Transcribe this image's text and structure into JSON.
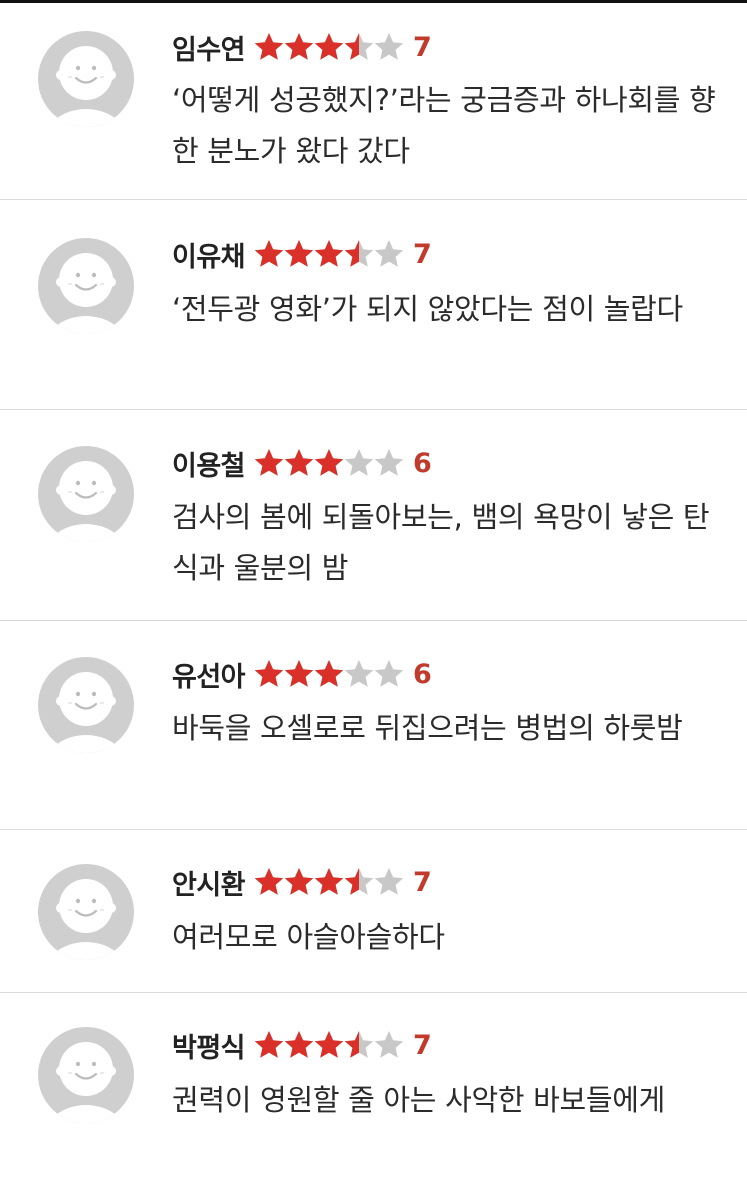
{
  "colors": {
    "star_filled": "#d9302a",
    "star_empty": "#c8c8c8",
    "score_text": "#c23a2c",
    "avatar_bg": "#cfcfcf",
    "avatar_face": "#ffffff"
  },
  "reviews": [
    {
      "name": "임수연",
      "rating_stars": 3.5,
      "score": "7",
      "text": "‘어떻게 성공했지?’라는 궁금증과 하나회를 향한 분노가 왔다 갔다"
    },
    {
      "name": "이유채",
      "rating_stars": 3.5,
      "score": "7",
      "text": "‘전두광 영화’가 되지 않았다는 점이 놀랍다"
    },
    {
      "name": "이용철",
      "rating_stars": 3,
      "score": "6",
      "text": "검사의 봄에 되돌아보는, 뱀의 욕망이 낳은 탄식과 울분의 밤"
    },
    {
      "name": "유선아",
      "rating_stars": 3,
      "score": "6",
      "text": "바둑을 오셀로로 뒤집으려는 병법의 하룻밤"
    },
    {
      "name": "안시환",
      "rating_stars": 3.5,
      "score": "7",
      "text": "여러모로 아슬아슬하다"
    },
    {
      "name": "박평식",
      "rating_stars": 3.5,
      "score": "7",
      "text": "권력이 영원할 줄 아는 사악한 바보들에게"
    }
  ]
}
